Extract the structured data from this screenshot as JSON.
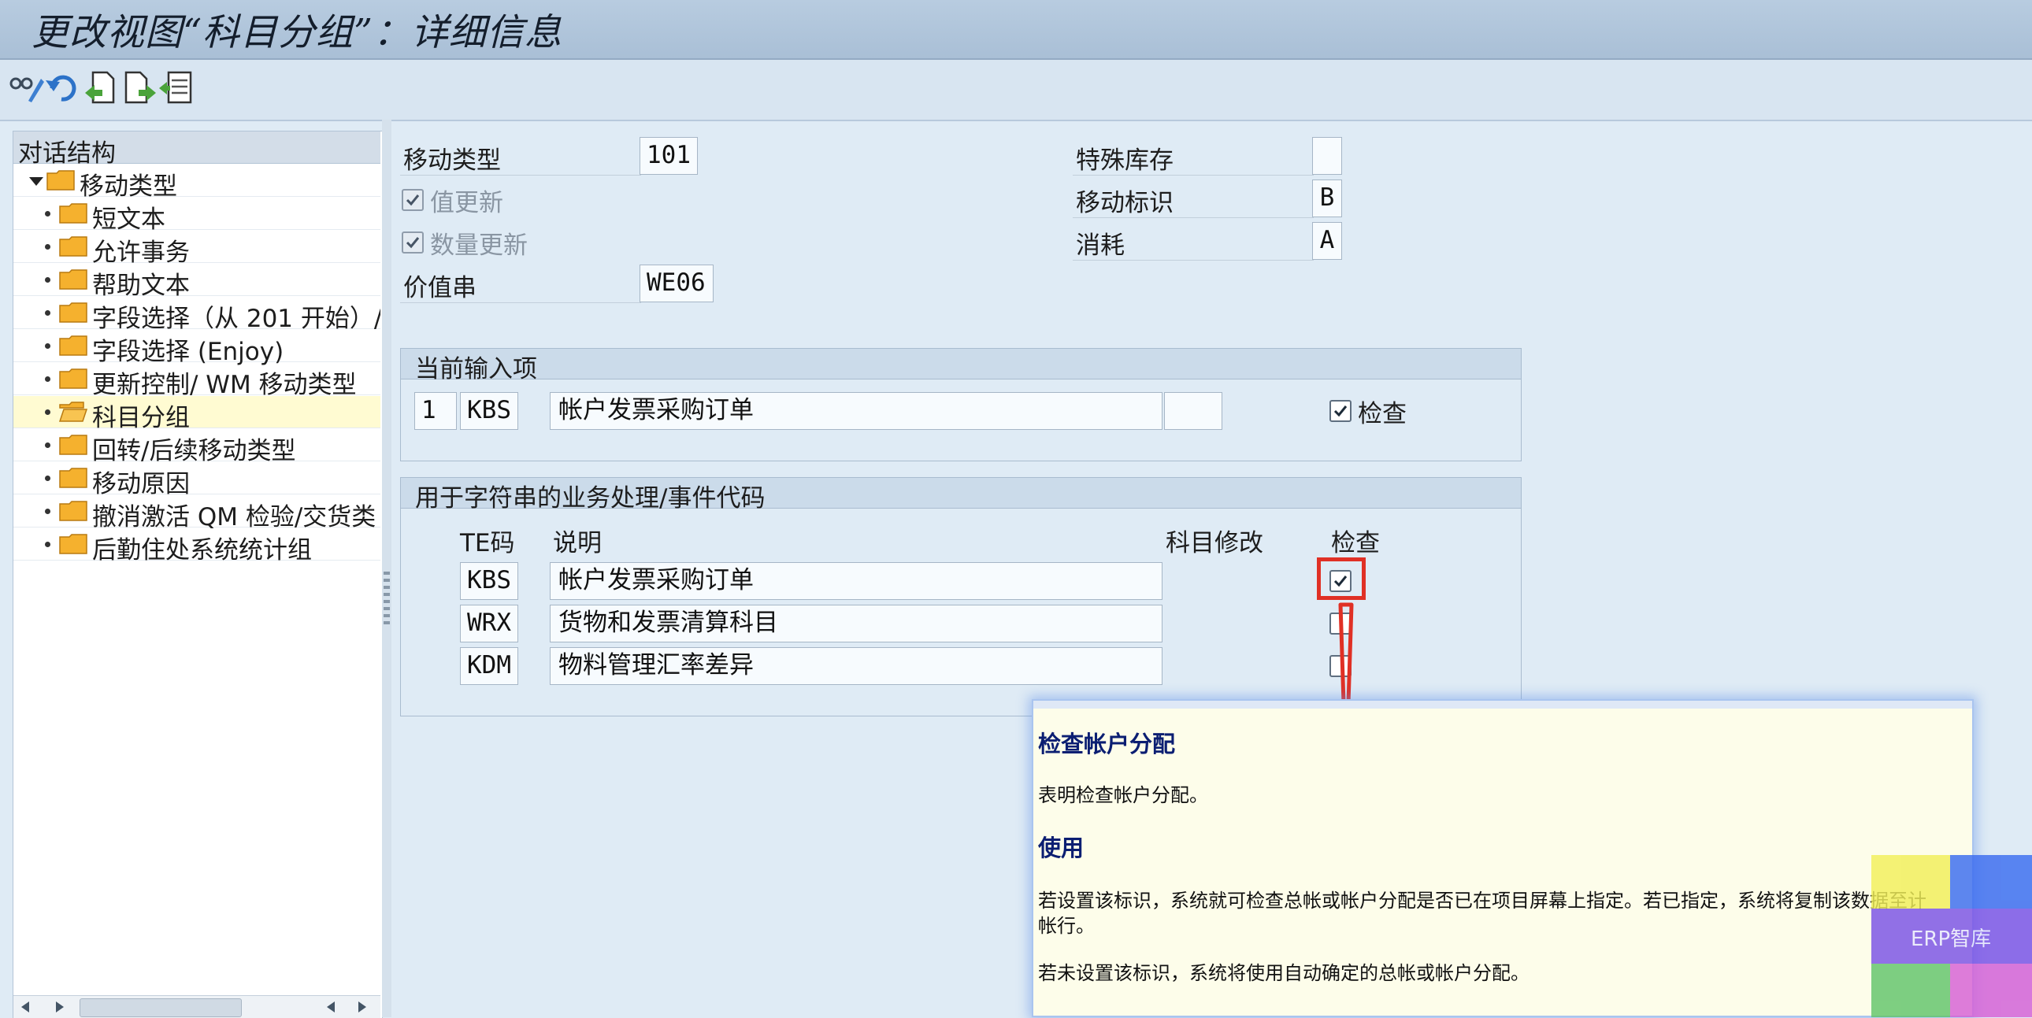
{
  "title": "更改视图“科目分组”：详细信息",
  "toolbar": {
    "buttons": [
      "glasses-pencil-icon",
      "undo-icon",
      "previous-entry-icon",
      "next-entry-icon",
      "select-block-icon"
    ]
  },
  "tree": {
    "header": "对话结构",
    "root": "移动类型",
    "items": [
      {
        "label": "短文本"
      },
      {
        "label": "允许事务"
      },
      {
        "label": "帮助文本"
      },
      {
        "label": "字段选择（从 201 开始）/"
      },
      {
        "label": "字段选择 (Enjoy)"
      },
      {
        "label": "更新控制/ WM 移动类型"
      },
      {
        "label": "科目分组",
        "selected": true
      },
      {
        "label": "回转/后续移动类型"
      },
      {
        "label": "移动原因"
      },
      {
        "label": "撤消激活 QM 检验/交货类"
      },
      {
        "label": "后勤住处系统统计组"
      }
    ]
  },
  "form": {
    "movement_type_label": "移动类型",
    "movement_type_value": "101",
    "value_update_label": "值更新",
    "value_update_checked": true,
    "qty_update_label": "数量更新",
    "qty_update_checked": true,
    "value_string_label": "价值串",
    "value_string_value": "WE06",
    "special_stock_label": "特殊库存",
    "special_stock_value": "",
    "movement_indicator_label": "移动标识",
    "movement_indicator_value": "B",
    "consumption_label": "消耗",
    "consumption_value": "A"
  },
  "current_entry": {
    "title": "当前输入项",
    "number": "1",
    "code": "KBS",
    "description": "帐户发票采购订单",
    "extra": "",
    "check_label": "检查",
    "check_checked": true
  },
  "event_codes": {
    "title": "用于字符串的业务处理/事件代码",
    "col_te": "TE码",
    "col_desc": "说明",
    "col_modify": "科目修改",
    "col_check": "检查",
    "rows": [
      {
        "code": "KBS",
        "description": "帐户发票采购订单",
        "checked": true
      },
      {
        "code": "WRX",
        "description": "货物和发票清算科目",
        "checked": false
      },
      {
        "code": "KDM",
        "description": "物料管理汇率差异",
        "checked": false
      }
    ]
  },
  "help_popup": {
    "heading1": "检查帐户分配",
    "text1": "表明检查帐户分配。",
    "heading2": "使用",
    "text2_line1": "若设置该标识，系统就可检查总帐或帐户分配是否已在项目屏幕上指定。若已指定，系统将复制该数据至计",
    "text2_line2": "帐行。",
    "text3": "若未设置该标识，系统将使用自动确定的总帐或帐户分配。"
  },
  "watermark": {
    "text": "ERP智库",
    "colors": [
      "#f1ef5a",
      "#3b6cf0",
      "#7a52e6",
      "#62c46a",
      "#d760d6"
    ]
  },
  "colors": {
    "highlight_red": "#e03025",
    "popup_heading": "#0b1e72"
  }
}
